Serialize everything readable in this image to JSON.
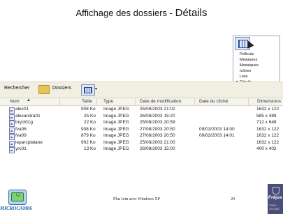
{
  "slide": {
    "title_part1": "Affichage des dossiers - ",
    "title_part2": "Détails"
  },
  "view_menu": {
    "items": [
      "Pellicule",
      "Miniatures",
      "Mosaïques",
      "Icônes",
      "Liste",
      "Détails"
    ],
    "selected": "Détails"
  },
  "toolbar": {
    "search_label": "Rechercher",
    "folders_label": "Dossiers"
  },
  "table": {
    "headers": [
      "Nom",
      "Taille",
      "Type",
      "Date de modification",
      "Date du cliché",
      "Dimensions"
    ],
    "rows": [
      {
        "name": "alex01",
        "size": "908 Ko",
        "type": "Image JPEG",
        "modified": "25/08/2003 21:02",
        "taken": "",
        "dims": "1632 x 122"
      },
      {
        "name": "alexandra01",
        "size": "25 Ko",
        "type": "Image JPEG",
        "modified": "26/08/2003 15:20",
        "taken": "",
        "dims": "585 x 489"
      },
      {
        "name": "bryct01g",
        "size": "22 Ko",
        "type": "Image JPEG",
        "modified": "25/08/2003 20:59",
        "taken": "",
        "dims": "712 x 648"
      },
      {
        "name": "fva06",
        "size": "938 Ko",
        "type": "Image JPEG",
        "modified": "27/08/2003 20:50",
        "taken": "09/03/2003 14:00",
        "dims": "1632 x 122"
      },
      {
        "name": "fva09",
        "size": "879 Ko",
        "type": "Image JPEG",
        "modified": "27/08/2003 20:50",
        "taken": "09/03/2003 14:01",
        "dims": "1632 x 122"
      },
      {
        "name": "leparcplatane",
        "size": "902 Ko",
        "type": "Image JPEG",
        "modified": "25/08/2003 21:00",
        "taken": "",
        "dims": "1632 x 122"
      },
      {
        "name": "yrc01",
        "size": "13 Ko",
        "type": "Image JPEG",
        "modified": "26/08/2003 15:00",
        "taken": "",
        "dims": "400 x 402"
      }
    ]
  },
  "footer": {
    "brand": "MICROCAM06",
    "text": "Plus loin avec Windows XP",
    "page": "29",
    "logo_title": "Fréjus",
    "logo_sub1": "Votre",
    "logo_sub2": "Accueil"
  }
}
